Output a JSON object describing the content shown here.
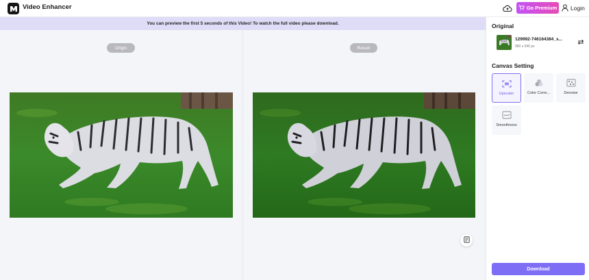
{
  "header": {
    "app_title": "Video Enhancer",
    "premium_label": "Go Premium",
    "login_label": "Login"
  },
  "notice": {
    "text": "You can preview the first 5 seconds of this Video! To watch the full video please download."
  },
  "canvas": {
    "origin_label": "Origin",
    "result_label": "Result"
  },
  "panel": {
    "original_title": "Original",
    "file": {
      "name": "129992-746164384_s...",
      "size": "960 x 540 px"
    },
    "canvas_setting_title": "Canvas Setting",
    "options": [
      {
        "label": "Upscaler",
        "icon": "upscaler-icon",
        "active": true
      },
      {
        "label": "Color Corre...",
        "icon": "color-correction-icon",
        "active": false
      },
      {
        "label": "Denoise",
        "icon": "denoise-icon",
        "active": false
      },
      {
        "label": "Smoothness",
        "icon": "smoothness-icon",
        "active": false
      }
    ],
    "download_label": "Download"
  },
  "colors": {
    "accent": "#7e6ef6",
    "notice_bg": "#dfdcf7",
    "premium_gradient_start": "#c253f5",
    "premium_gradient_end": "#e64bb6"
  }
}
